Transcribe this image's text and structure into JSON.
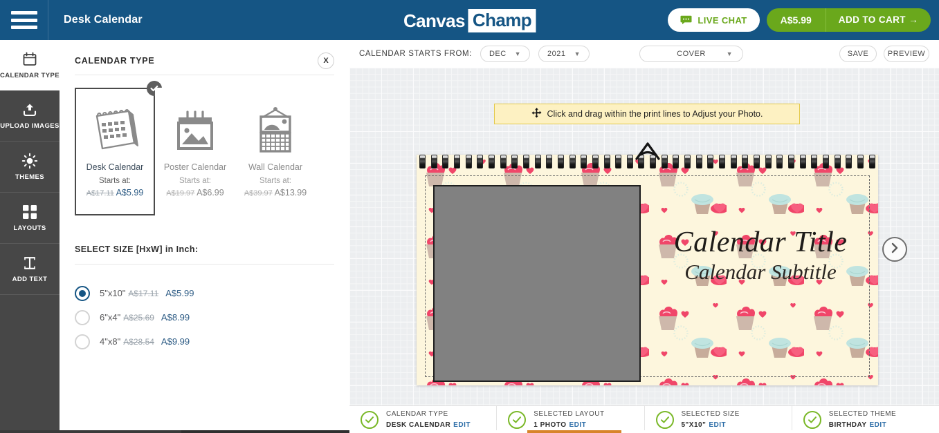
{
  "header": {
    "menu_icon": "hamburger-menu-icon",
    "title": "Desk Calendar",
    "logo_part1": "Canvas",
    "logo_part2": "Champ",
    "live_chat": "LIVE CHAT",
    "chat_icon": "chat-bubble-icon",
    "cart_price": "A$5.99",
    "cart_label": "ADD TO CART →",
    "bg_color": "#155584",
    "accent_green": "#6aa81c"
  },
  "rail": {
    "items": [
      {
        "label": "CALENDAR TYPE",
        "icon": "calendar-icon",
        "active": true
      },
      {
        "label": "UPLOAD IMAGES",
        "icon": "upload-icon",
        "active": false
      },
      {
        "label": "THEMES",
        "icon": "sun-theme-icon",
        "active": false
      },
      {
        "label": "LAYOUTS",
        "icon": "grid-layout-icon",
        "active": false
      },
      {
        "label": "ADD TEXT",
        "icon": "text-tool-icon",
        "active": false
      }
    ]
  },
  "panel": {
    "title": "CALENDAR TYPE",
    "close_label": "X",
    "types": [
      {
        "name": "Desk Calendar",
        "starts_at": "Starts at:",
        "old_price": "A$17.11",
        "price": "A$5.99",
        "selected": true,
        "icon": "desk-calendar-icon"
      },
      {
        "name": "Poster Calendar",
        "starts_at": "Starts at:",
        "old_price": "A$19.97",
        "price": "A$6.99",
        "selected": false,
        "icon": "poster-calendar-icon"
      },
      {
        "name": "Wall Calendar",
        "starts_at": "Starts at:",
        "old_price": "A$39.97",
        "price": "A$13.99",
        "selected": false,
        "icon": "wall-calendar-icon"
      }
    ],
    "size_heading": "SELECT SIZE [HxW] in Inch:",
    "sizes": [
      {
        "dim": "5\"x10\"",
        "old_price": "A$17.11",
        "price": "A$5.99",
        "selected": true
      },
      {
        "dim": "6\"x4\"",
        "old_price": "A$25.69",
        "price": "A$8.99",
        "selected": false
      },
      {
        "dim": "4\"x8\"",
        "old_price": "A$28.54",
        "price": "A$9.99",
        "selected": false
      }
    ]
  },
  "toolbar": {
    "starts_from_label": "CALENDAR STARTS FROM:",
    "month": "DEC",
    "year": "2021",
    "page": "COVER",
    "save": "SAVE",
    "preview": "PREVIEW",
    "caret_icon": "chevron-down-icon"
  },
  "canvas": {
    "hint_text": "Click and drag within the print lines to Adjust your Photo.",
    "hint_icon": "move-arrows-icon",
    "hint_bg": "#fdf1c2",
    "hint_border": "#e3c94a",
    "calendar_title": "Calendar Title",
    "calendar_subtitle": "Calendar Subtitle",
    "next_icon": "chevron-right-icon",
    "paper_color": "#fdf6dd",
    "photo_placeholder_color": "#818181"
  },
  "statusbar": {
    "items": [
      {
        "key": "CALENDAR TYPE",
        "value": "DESK CALENDAR",
        "edit": "EDIT",
        "icon": "check-circle-icon"
      },
      {
        "key": "SELECTED LAYOUT",
        "value": "1 PHOTO",
        "edit": "EDIT",
        "icon": "check-circle-icon"
      },
      {
        "key": "SELECTED SIZE",
        "value": "5\"X10\"",
        "edit": "EDIT",
        "icon": "check-circle-icon"
      },
      {
        "key": "SELECTED THEME",
        "value": "BIRTHDAY",
        "edit": "EDIT",
        "icon": "check-circle-icon"
      }
    ],
    "check_color": "#7ab828",
    "edit_color": "#2e6ea8"
  }
}
